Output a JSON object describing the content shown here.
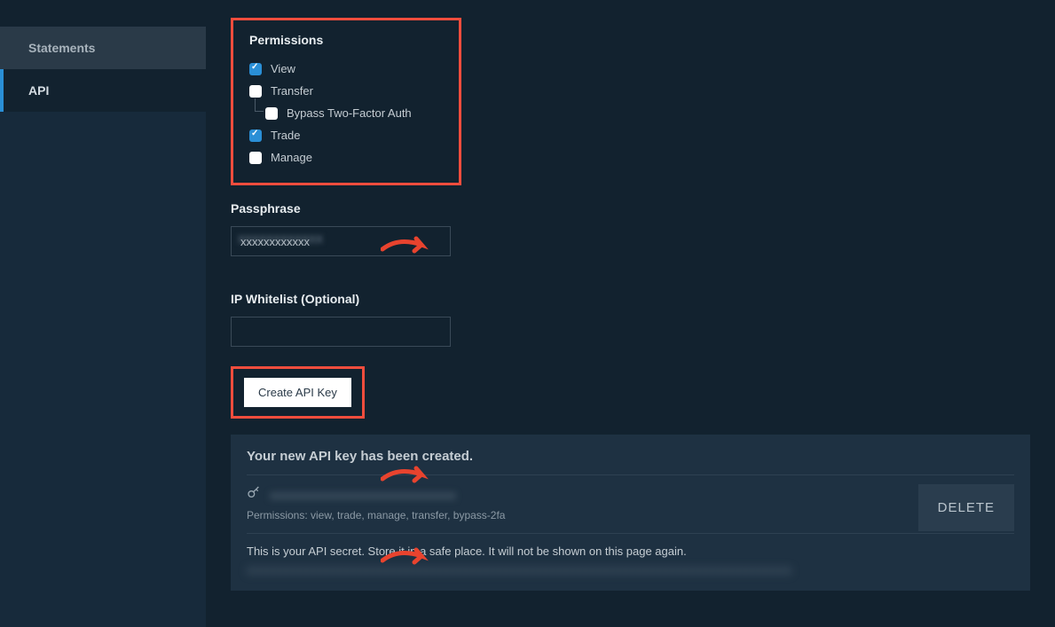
{
  "sidebar": {
    "items": [
      {
        "label": "Statements"
      },
      {
        "label": "API"
      }
    ]
  },
  "permissions": {
    "title": "Permissions",
    "items": {
      "view": "View",
      "transfer": "Transfer",
      "bypass": "Bypass Two-Factor Auth",
      "trade": "Trade",
      "manage": "Manage"
    },
    "checked": {
      "view": true,
      "transfer": false,
      "bypass": false,
      "trade": true,
      "manage": false
    }
  },
  "passphrase": {
    "label": "Passphrase",
    "value": "xxxxxxxxxxxx"
  },
  "ipwhitelist": {
    "label": "IP Whitelist (Optional)",
    "value": ""
  },
  "create_button_label": "Create API Key",
  "result": {
    "title": "Your new API key has been created.",
    "key_value": "xxxxxxxxxxxxxxxxxxxxxxxxxxxxxx",
    "permissions_line": "Permissions: view, trade, manage, transfer, bypass-2fa",
    "delete_label": "DELETE",
    "secret_msg": "This is your API secret. Store it in a safe place. It will not be shown on this page again.",
    "secret_value": "xxxxxxxxxxxxxxxxxxxxxxxxxxxxxxxxxxxxxxxxxxxxxxxxxxxxxxxxxxxxxxxxxxxxxxxxxxxxxxxxxx"
  },
  "colors": {
    "accent": "#2a8fd6",
    "highlight": "#f34d3d"
  }
}
